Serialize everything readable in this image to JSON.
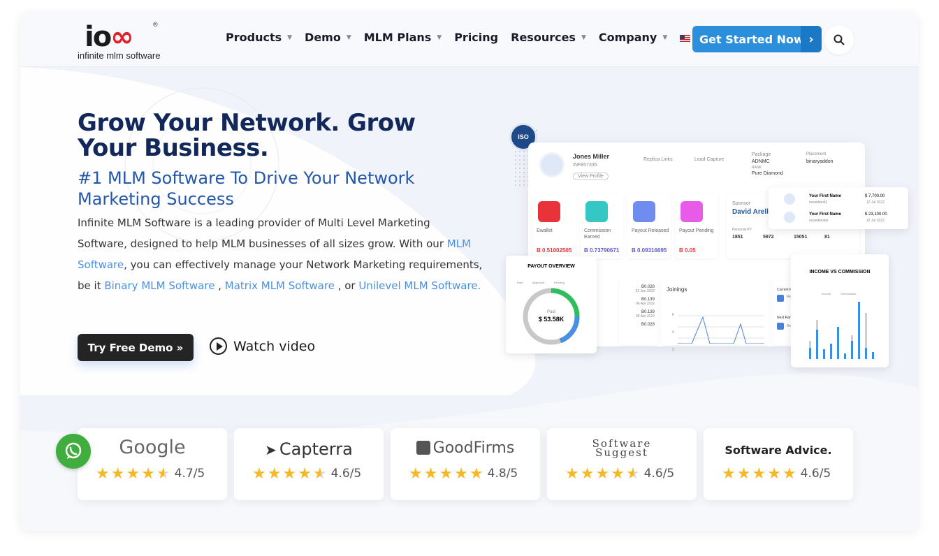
{
  "header": {
    "logo_mark": "iOO",
    "logo_tagline": "infinite mlm software",
    "logo_registered": "®",
    "nav": [
      {
        "label": "Products",
        "has_dropdown": true
      },
      {
        "label": "Demo",
        "has_dropdown": true
      },
      {
        "label": "MLM Plans",
        "has_dropdown": true
      },
      {
        "label": "Pricing",
        "has_dropdown": false
      },
      {
        "label": "Resources",
        "has_dropdown": true
      },
      {
        "label": "Company",
        "has_dropdown": true
      }
    ],
    "language_icon": "us-flag-icon",
    "cta_label": "Get Started Now",
    "cta_arrow": "›",
    "search_icon": "search-icon"
  },
  "hero": {
    "title": "Grow Your Network. Grow Your Business.",
    "subtitle": "#1 MLM Software To Drive Your Network Marketing Success",
    "desc_1": "Infinite MLM Software is a leading provider of Multi Level Marketing Software, designed to help MLM businesses of all sizes grow. With our ",
    "link_mlm": "MLM Software",
    "desc_2": ", you can effectively manage your Network Marketing requirements, be it ",
    "link_binary": "Binary MLM Software",
    "desc_3": " , ",
    "link_matrix": "Matrix MLM Software",
    "desc_4": " , or ",
    "link_unilevel": "Unilevel MLM Software.",
    "demo_button": "Try Free Demo »",
    "watch_video": "Watch video"
  },
  "dashboard": {
    "profile_name": "Jones Miller",
    "profile_id": "INF857335",
    "view_profile": "View Profile",
    "replica_links": "Replica Links",
    "lead_capture": "Lead Capture",
    "package_label": "Package",
    "package_value": "ADNMC",
    "rank_label": "RANK",
    "rank_value": "Pure Diamond",
    "placement_label": "Placement",
    "placement_value": "binaryaddon",
    "tiles": [
      {
        "label": "Ewallet",
        "value": "B 0.51002505",
        "color": "#e8333a"
      },
      {
        "label": "Commission Earned",
        "value": "B 0.73790671",
        "color": "#35c7c3"
      },
      {
        "label": "Payout Released",
        "value": "B 0.09316695",
        "color": "#6f8cf0"
      },
      {
        "label": "Payout Pending",
        "value": "B 0.05",
        "color": "#e85ae8"
      }
    ],
    "sponsor_label": "Sponsor",
    "sponsor_name": "David Arell",
    "personal_pv_label": "Personal PV",
    "personal_pv": "1851",
    "group_pv": "5972",
    "left_carry": "15051",
    "right_carry": "81",
    "earners": [
      {
        "name": "Your First Name",
        "user": "noranktest2",
        "amount": "$ 7,700.00",
        "date": "12 Jul 2022"
      },
      {
        "name": "Your First Name",
        "user": "noranktester",
        "amount": "$ 23,100.00",
        "date": "12 Jul 2022"
      }
    ],
    "payout_title": "PAYOUT OVERVIEW",
    "payout_legend": [
      "Paid",
      "Approved",
      "Pending"
    ],
    "payout_center_label": "Paid",
    "payout_center_value": "$ 53.58K",
    "transactions": [
      {
        "amount": "B0.028",
        "date": "22 Jun 2022"
      },
      {
        "amount": "B0.139",
        "date": "06 Apr 2022"
      },
      {
        "amount": "B0.139",
        "date": "06 Apr 2022"
      },
      {
        "amount": "B0.028",
        "date": ""
      }
    ],
    "joinings_title": "Joinings",
    "joinings_ticks": [
      "6",
      "4",
      "2"
    ],
    "current_rank": "Current Rank - P",
    "referral_count": "Referral Co",
    "next_rank": "Next Rank - Dia",
    "income_title": "INCOME VS COMMISSION",
    "income_legend": [
      "Income",
      "Commission"
    ]
  },
  "reviews": [
    {
      "brand": "Google",
      "score": "4.7/5",
      "stars": 4.5
    },
    {
      "brand": "Capterra",
      "score": "4.6/5",
      "stars": 4.5
    },
    {
      "brand": "GoodFirms",
      "score": "4.8/5",
      "stars": 5
    },
    {
      "brand": "Software Suggest",
      "score": "4.6/5",
      "stars": 4.5
    },
    {
      "brand": "Software Advice.",
      "score": "4.6/5",
      "stars": 5
    }
  ],
  "colors": {
    "primary": "#2b8fdc",
    "heading": "#12285b",
    "accent": "#2358a8",
    "star": "#f6b925"
  }
}
